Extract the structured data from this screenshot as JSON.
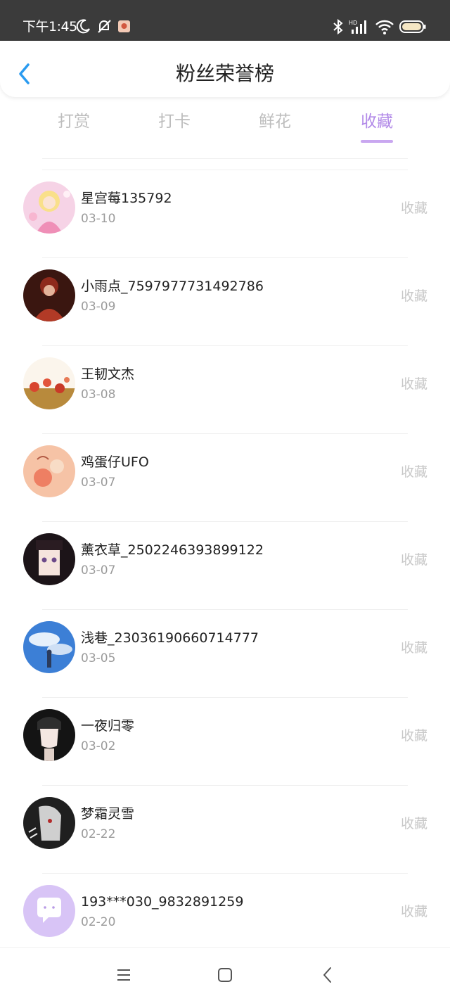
{
  "status_bar": {
    "time": "下午1:45",
    "icons": [
      "moon-icon",
      "bell-off-icon",
      "app-notification-icon",
      "bluetooth-icon",
      "signal-hd-icon",
      "wifi-icon",
      "battery-icon"
    ]
  },
  "header": {
    "title": "粉丝荣誉榜",
    "back_icon": "chevron-left-icon"
  },
  "tabs": [
    {
      "label": "打赏",
      "active": false
    },
    {
      "label": "打卡",
      "active": false
    },
    {
      "label": "鲜花",
      "active": false
    },
    {
      "label": "收藏",
      "active": true
    }
  ],
  "colors": {
    "accent": "#b28ae8",
    "inactive_tab": "#bdbdbd",
    "action_text": "#c8c8c8",
    "status_bar": "#3b3b3b"
  },
  "fans": [
    {
      "name": "星宫莓135792",
      "date": "03-10",
      "action": "收藏",
      "avatar": "anime-girl-pink-avatar"
    },
    {
      "name": "小雨点_7597977731492786",
      "date": "03-09",
      "action": "收藏",
      "avatar": "portrait-red-avatar"
    },
    {
      "name": "王韧文杰",
      "date": "03-08",
      "action": "收藏",
      "avatar": "flowers-avatar"
    },
    {
      "name": "鸡蛋仔UFO",
      "date": "03-07",
      "action": "收藏",
      "avatar": "peach-illustration-avatar"
    },
    {
      "name": "薰衣草_2502246393899122",
      "date": "03-07",
      "action": "收藏",
      "avatar": "anime-girl-dark-hair-avatar"
    },
    {
      "name": "浅巷_23036190660714777",
      "date": "03-05",
      "action": "收藏",
      "avatar": "sky-figure-avatar"
    },
    {
      "name": "一夜归零",
      "date": "03-02",
      "action": "收藏",
      "avatar": "anime-boy-avatar"
    },
    {
      "name": "梦霜灵雪",
      "date": "02-22",
      "action": "收藏",
      "avatar": "sketch-face-avatar"
    },
    {
      "name": "193***030_9832891259",
      "date": "02-20",
      "action": "收藏",
      "avatar": "default-chat-avatar"
    }
  ],
  "navbar": {
    "icons": [
      "menu-icon",
      "home-square-icon",
      "back-triangle-icon"
    ]
  }
}
